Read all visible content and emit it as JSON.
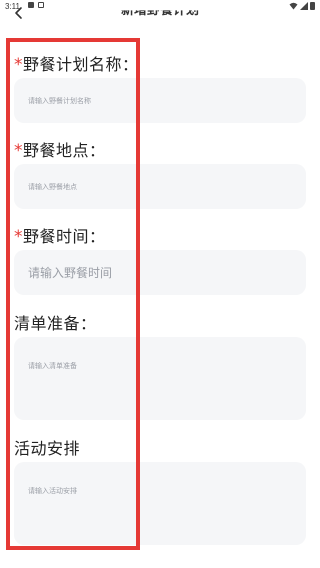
{
  "status_bar": {
    "time": "3:11"
  },
  "header": {
    "title": "新增野餐计划"
  },
  "form": {
    "plan_name": {
      "required_mark": "*",
      "label": "野餐计划名称：",
      "placeholder": "请输入野餐计划名称"
    },
    "location": {
      "required_mark": "*",
      "label": "野餐地点：",
      "placeholder": "请输入野餐地点"
    },
    "time": {
      "required_mark": "*",
      "label": "野餐时间：",
      "placeholder": "请输入野餐时间"
    },
    "checklist": {
      "label": "清单准备：",
      "placeholder": "请输入清单准备"
    },
    "activities": {
      "label": "活动安排",
      "placeholder": "请输入活动安排"
    }
  },
  "colors": {
    "highlight_frame": "#e53935",
    "required_mark": "#e53935",
    "field_background": "#f5f6f8",
    "placeholder": "#9a9ea6"
  }
}
